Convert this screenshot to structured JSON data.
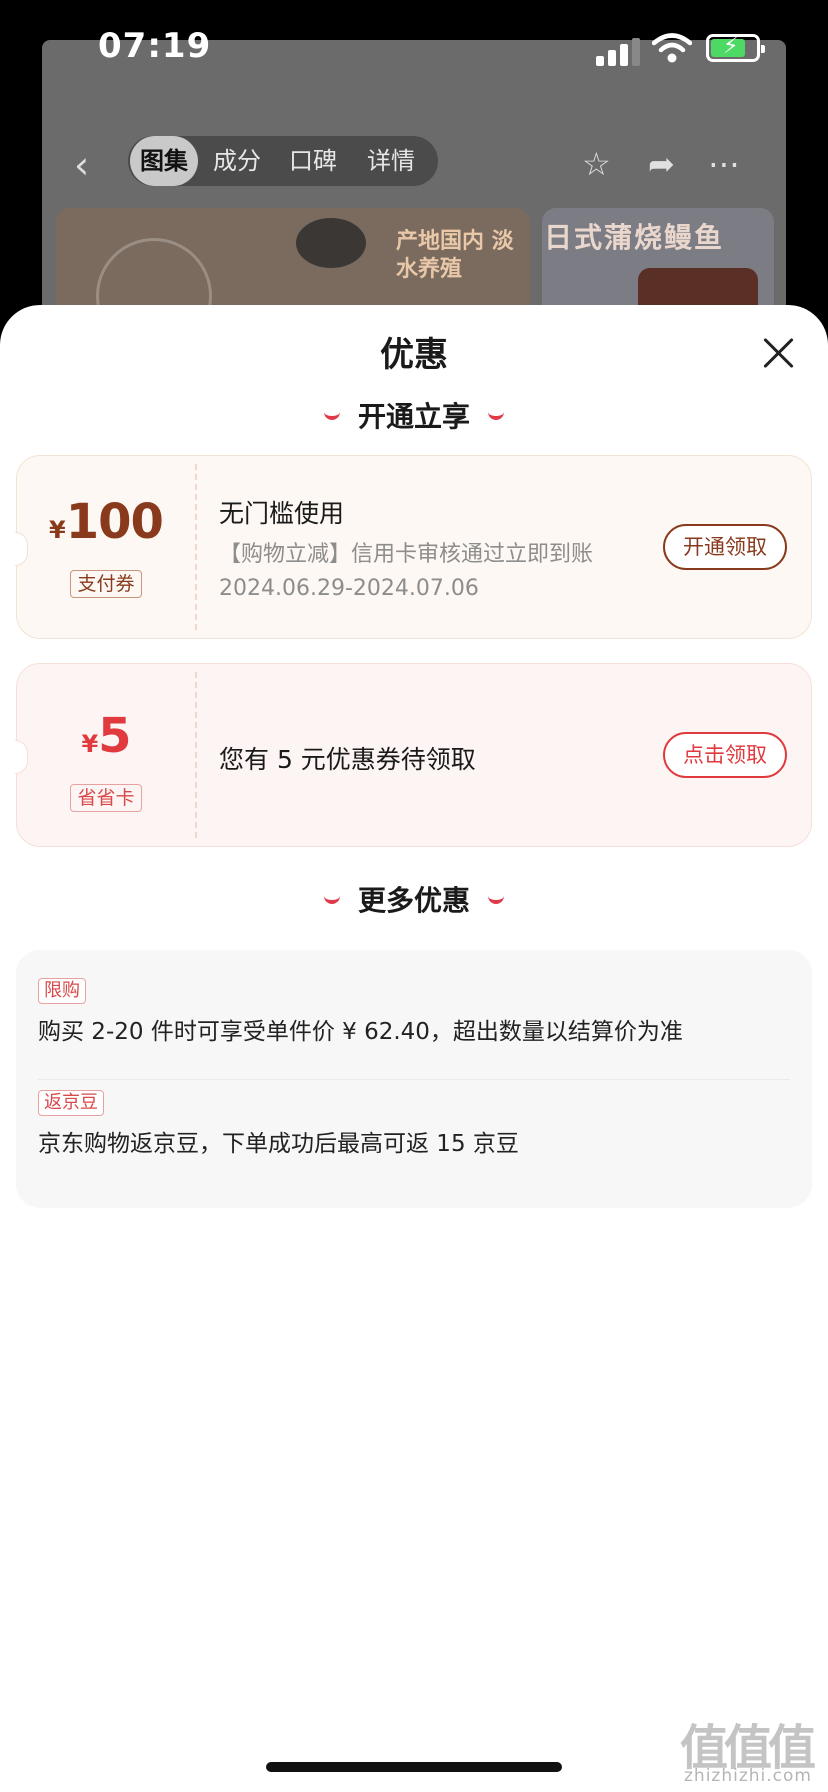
{
  "status_bar": {
    "time": "07:19"
  },
  "background_page": {
    "tabs": [
      "图集",
      "成分",
      "口碑",
      "详情"
    ],
    "active_tab": "图集",
    "photo_1_label": "产地国内 淡水养殖",
    "photo_2_label": "日式蒲烧鳗鱼",
    "icons": [
      "back-icon",
      "star-icon",
      "share-icon",
      "more-icon"
    ]
  },
  "sheet": {
    "title": "优惠",
    "section_1": "开通立享",
    "coupons": [
      {
        "currency": "¥",
        "amount": "100",
        "tag": "支付券",
        "title": "无门槛使用",
        "desc": "【购物立减】信用卡审核通过立即到账",
        "date": "2024.06.29-2024.07.06",
        "button": "开通领取"
      },
      {
        "currency": "¥",
        "amount": "5",
        "tag": "省省卡",
        "title": "您有 5 元优惠券待领取",
        "button": "点击领取"
      }
    ],
    "section_2": "更多优惠",
    "offers": [
      {
        "tag": "限购",
        "text": "购买 2-20 件时可享受单件价 ¥ 62.40，超出数量以结算价为准"
      },
      {
        "tag": "返京豆",
        "text": "京东购物返京豆，下单成功后最高可返 15 京豆"
      }
    ]
  },
  "watermark": {
    "logo": "值值值",
    "text": "zhizhizhi.com"
  },
  "colors": {
    "accent_red": "#e0393e",
    "brown": "#8a3a1c",
    "battery_green": "#4cd964"
  }
}
